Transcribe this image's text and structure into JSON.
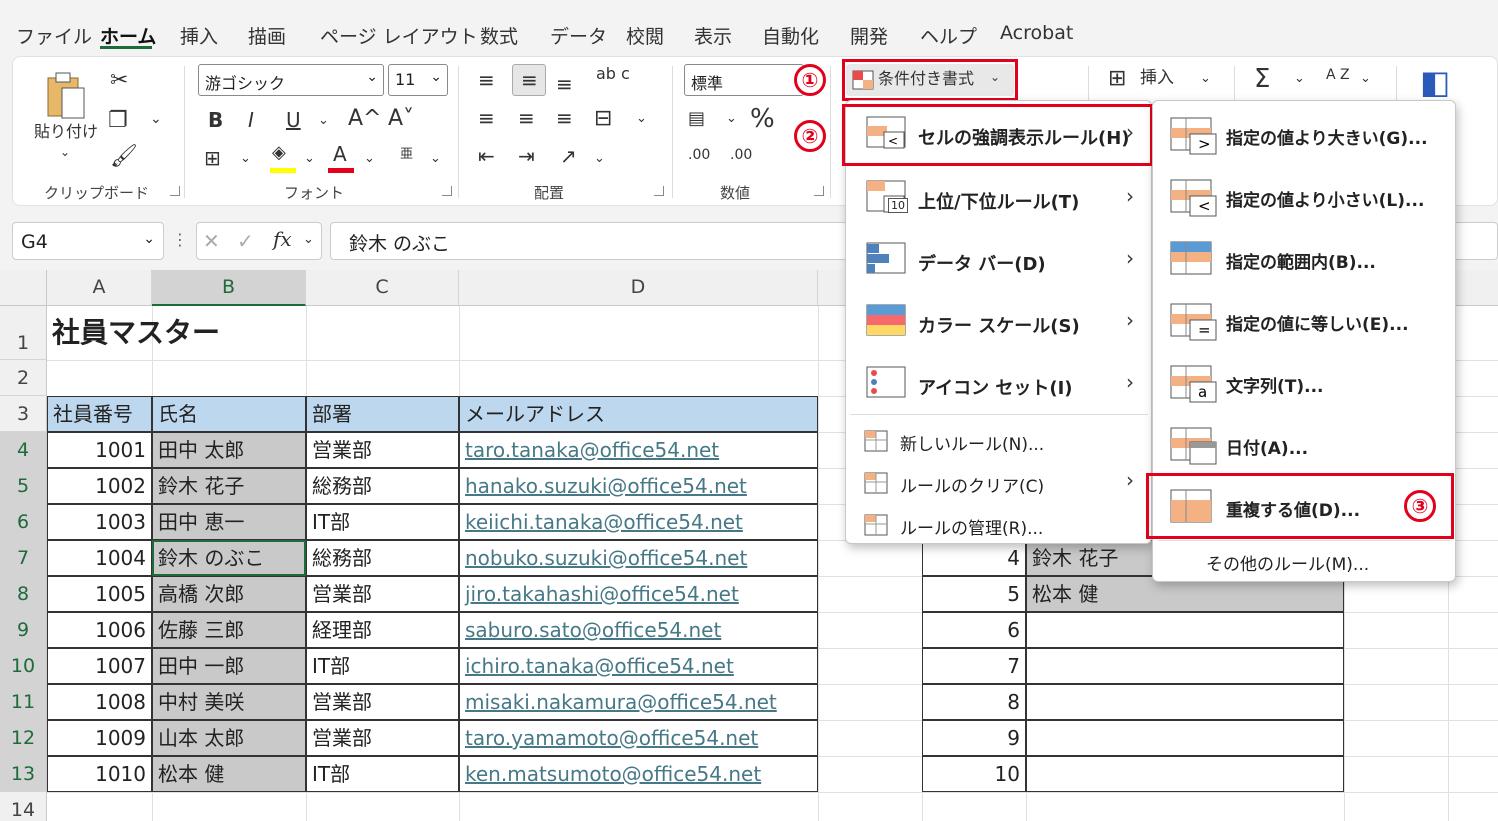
{
  "tabs": [
    "ファイル",
    "ホーム",
    "挿入",
    "描画",
    "ページ レイアウト",
    "数式",
    "データ",
    "校閲",
    "表示",
    "自動化",
    "開発",
    "ヘルプ",
    "Acrobat"
  ],
  "ribbon": {
    "paste_label": "貼り付け",
    "clipboard_group": "クリップボード",
    "font_name": "游ゴシック",
    "font_size": "11",
    "font_group": "フォント",
    "align_group": "配置",
    "number_format": "標準",
    "number_group": "数値",
    "conditional_format": "条件付き書式",
    "insert_label": "挿入",
    "percent": "%",
    "sigma": "Σ",
    "sort_label": "A Z",
    "wrap_label": "ab c",
    "bold": "B",
    "italic": "I",
    "underline": "U",
    "ruby": "亜",
    "inc_font": "A^",
    "dec_font": "A˅",
    "font_color": "A",
    "dec_inc": ".00",
    "dec_dec": ".00"
  },
  "formula_bar": {
    "name_box": "G4",
    "fx": "fx",
    "content": "鈴木 のぶこ"
  },
  "columns": [
    "A",
    "B",
    "C",
    "D"
  ],
  "rows": [
    "1",
    "2",
    "3",
    "4",
    "5",
    "6",
    "7",
    "8",
    "9",
    "10",
    "11",
    "12",
    "13",
    "14"
  ],
  "sheet": {
    "title": "社員マスター",
    "headers": [
      "社員番号",
      "氏名",
      "部署",
      "メールアドレス"
    ],
    "records": [
      {
        "id": "1001",
        "name": "田中 太郎",
        "dept": "営業部",
        "email": "taro.tanaka@office54.net"
      },
      {
        "id": "1002",
        "name": "鈴木 花子",
        "dept": "総務部",
        "email": "hanako.suzuki@office54.net"
      },
      {
        "id": "1003",
        "name": "田中 恵一",
        "dept": "IT部",
        "email": "keiichi.tanaka@office54.net"
      },
      {
        "id": "1004",
        "name": "鈴木 のぶこ",
        "dept": "総務部",
        "email": "nobuko.suzuki@office54.net"
      },
      {
        "id": "1005",
        "name": "高橋 次郎",
        "dept": "営業部",
        "email": "jiro.takahashi@office54.net"
      },
      {
        "id": "1006",
        "name": "佐藤 三郎",
        "dept": "経理部",
        "email": "saburo.sato@office54.net"
      },
      {
        "id": "1007",
        "name": "田中 一郎",
        "dept": "IT部",
        "email": "ichiro.tanaka@office54.net"
      },
      {
        "id": "1008",
        "name": "中村 美咲",
        "dept": "営業部",
        "email": "misaki.nakamura@office54.net"
      },
      {
        "id": "1009",
        "name": "山本 太郎",
        "dept": "営業部",
        "email": "taro.yamamoto@office54.net"
      },
      {
        "id": "1010",
        "name": "松本 健",
        "dept": "IT部",
        "email": "ken.matsumoto@office54.net"
      }
    ],
    "side_table": [
      {
        "no": "4",
        "name": "鈴木 花子"
      },
      {
        "no": "5",
        "name": "松本 健"
      },
      {
        "no": "6",
        "name": ""
      },
      {
        "no": "7",
        "name": ""
      },
      {
        "no": "8",
        "name": ""
      },
      {
        "no": "9",
        "name": ""
      },
      {
        "no": "10",
        "name": ""
      }
    ]
  },
  "menu": {
    "items": [
      {
        "label": "セルの強調表示ルール(H)",
        "icon": "highlight-rules-icon"
      },
      {
        "label": "上位/下位ルール(T)",
        "icon": "top-bottom-icon"
      },
      {
        "label": "データ バー(D)",
        "icon": "data-bar-icon"
      },
      {
        "label": "カラー スケール(S)",
        "icon": "color-scale-icon"
      },
      {
        "label": "アイコン セット(I)",
        "icon": "icon-set-icon"
      }
    ],
    "extra": [
      "新しいルール(N)...",
      "ルールのクリア(C)",
      "ルールの管理(R)..."
    ],
    "icon10": "10"
  },
  "submenu": {
    "items": [
      {
        "label": "指定の値より大きい(G)...",
        "sym": ">"
      },
      {
        "label": "指定の値より小さい(L)...",
        "sym": "<"
      },
      {
        "label": "指定の範囲内(B)...",
        "sym": ""
      },
      {
        "label": "指定の値に等しい(E)...",
        "sym": "="
      },
      {
        "label": "文字列(T)...",
        "sym": "a"
      },
      {
        "label": "日付(A)...",
        "sym": ""
      },
      {
        "label": "重複する値(D)...",
        "sym": ""
      }
    ],
    "other": "その他のルール(M)..."
  },
  "badges": [
    "①",
    "②",
    "③"
  ],
  "colors": {
    "accent": "#1e6a3a",
    "header_fill": "#bdd7ee",
    "dup_fill": "#c9c9c9",
    "annotation": "#e3001b"
  }
}
